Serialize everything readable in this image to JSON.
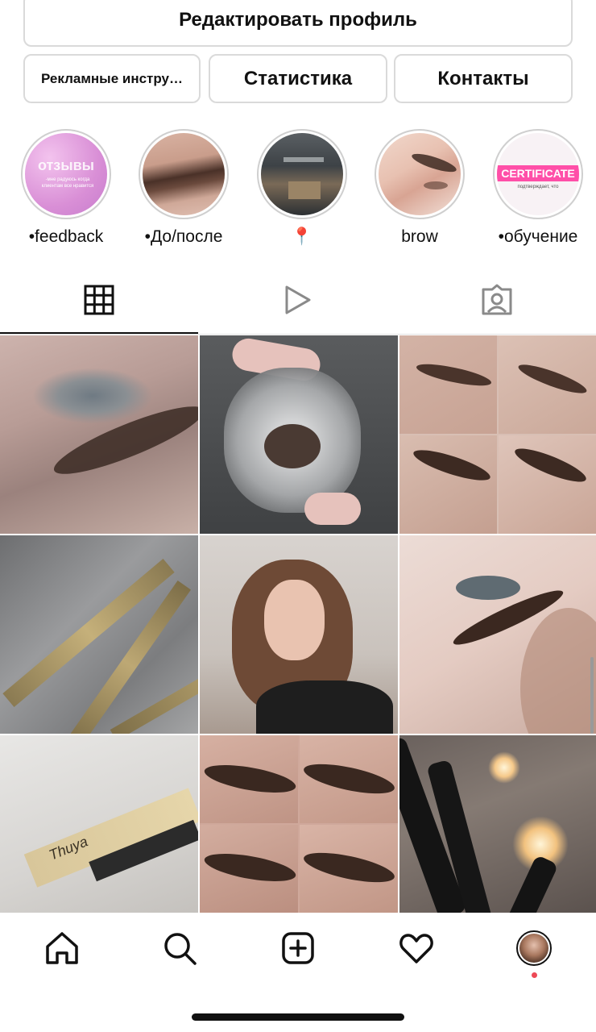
{
  "profile_actions": {
    "edit_profile": "Редактировать профиль",
    "ad_tools": "Рекламные инстру…",
    "statistics": "Статистика",
    "contacts": "Контакты"
  },
  "highlights": [
    {
      "label": "•feedback",
      "cover_text": "отзывы",
      "cover_subtext": "-мне радуюсь когда клиентам все нравится"
    },
    {
      "label": "•До/после"
    },
    {
      "label": "📍"
    },
    {
      "label": "brow"
    },
    {
      "label": "•обучение",
      "cover_text": "CERTIFICATE",
      "cover_subtext": "подтверждает, что"
    }
  ],
  "tabs": [
    {
      "icon": "grid-icon",
      "selected": true
    },
    {
      "icon": "reels-icon",
      "selected": false
    },
    {
      "icon": "tagged-icon",
      "selected": false
    }
  ],
  "grid_posts": [
    {
      "subject": "brow-closeup"
    },
    {
      "subject": "henna-jar"
    },
    {
      "subject": "brow-collage"
    },
    {
      "subject": "tweezers"
    },
    {
      "subject": "selfie-portrait"
    },
    {
      "subject": "brow-and-lash"
    },
    {
      "subject": "thuya-product",
      "product_text": "Thuya"
    },
    {
      "subject": "brow-collage-2"
    },
    {
      "subject": "mascara-brushes-candles"
    }
  ],
  "bottom_nav": [
    {
      "icon": "home-icon"
    },
    {
      "icon": "search-icon"
    },
    {
      "icon": "create-post-icon"
    },
    {
      "icon": "activity-heart-icon"
    },
    {
      "icon": "profile-avatar",
      "has_notification_dot": true
    }
  ],
  "colors": {
    "accent_notification": "#ed4956",
    "button_border": "#dadada",
    "text": "#111111"
  }
}
